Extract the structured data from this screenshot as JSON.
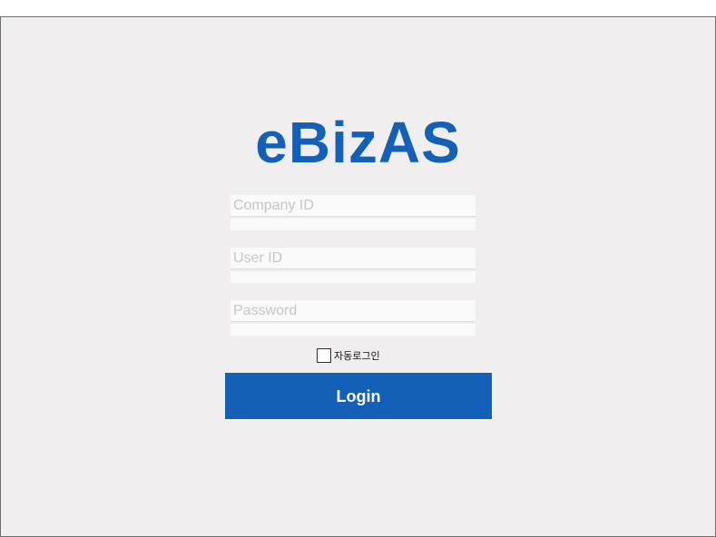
{
  "app": {
    "logo_text": "eBizAS"
  },
  "form": {
    "company_id": {
      "placeholder": "Company ID",
      "value": ""
    },
    "user_id": {
      "placeholder": "User ID",
      "value": ""
    },
    "password": {
      "placeholder": "Password",
      "value": ""
    },
    "auto_login": {
      "label": "자동로그인",
      "checked": false
    },
    "login_button": {
      "label": "Login"
    }
  },
  "colors": {
    "brand": "#1360b9",
    "background": "#f0eeef",
    "field": "#fafafa"
  }
}
